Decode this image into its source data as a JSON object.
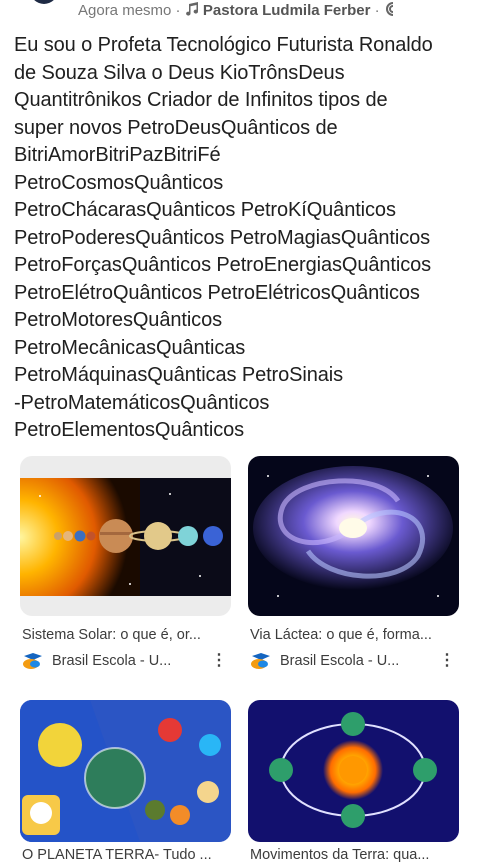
{
  "header": {
    "time": "Agora mesmo",
    "separator": "·",
    "author": "Pastora Ludmila Ferber",
    "music_icon": "music-note-icon",
    "sound_icon": "sound-icon"
  },
  "post": {
    "lines": [
      "Eu sou o Profeta Tecnológico Futurista Ronaldo",
      "de Souza Silva o Deus KioTrônsDeus",
      "Quantitrônikos Criador de Infinitos tipos de",
      "super novos PetroDeusQuânticos de",
      "BitriAmorBitriPazBitriFé",
      "PetroCosmosQuânticos",
      "PetroChácarasQuânticos PetroKíQuânticos",
      "PetroPoderesQuânticos PetroMagiasQuânticos",
      "PetroForçasQuânticos PetroEnergiasQuânticos",
      "PetroElétroQuânticos PetroElétricosQuânticos",
      "PetroMotoresQuânticos",
      "PetroMecânicasQuânticas",
      "PetroMáquinasQuânticas PetroSinais",
      "-PetroMatemáticosQuânticos",
      "PetroElementosQuânticos"
    ]
  },
  "results": [
    {
      "caption": "Sistema Solar: o que é, or...",
      "source": "Brasil Escola - U...",
      "menu": "⋮",
      "image": "solar-system"
    },
    {
      "caption": "Via Láctea: o que é, forma...",
      "source": "Brasil Escola - U...",
      "menu": "⋮",
      "image": "milky-way"
    },
    {
      "caption": "O PLANETA TERRA- Tudo ...",
      "source": "",
      "menu": "",
      "image": "planet-earth-collage"
    },
    {
      "caption": "Movimentos da Terra: qua...",
      "source": "",
      "menu": "",
      "image": "earth-orbit"
    }
  ],
  "colors": {
    "text": "#202020",
    "meta": "#777777",
    "favicon_orange": "#f39c12",
    "favicon_blue": "#1565c0"
  }
}
